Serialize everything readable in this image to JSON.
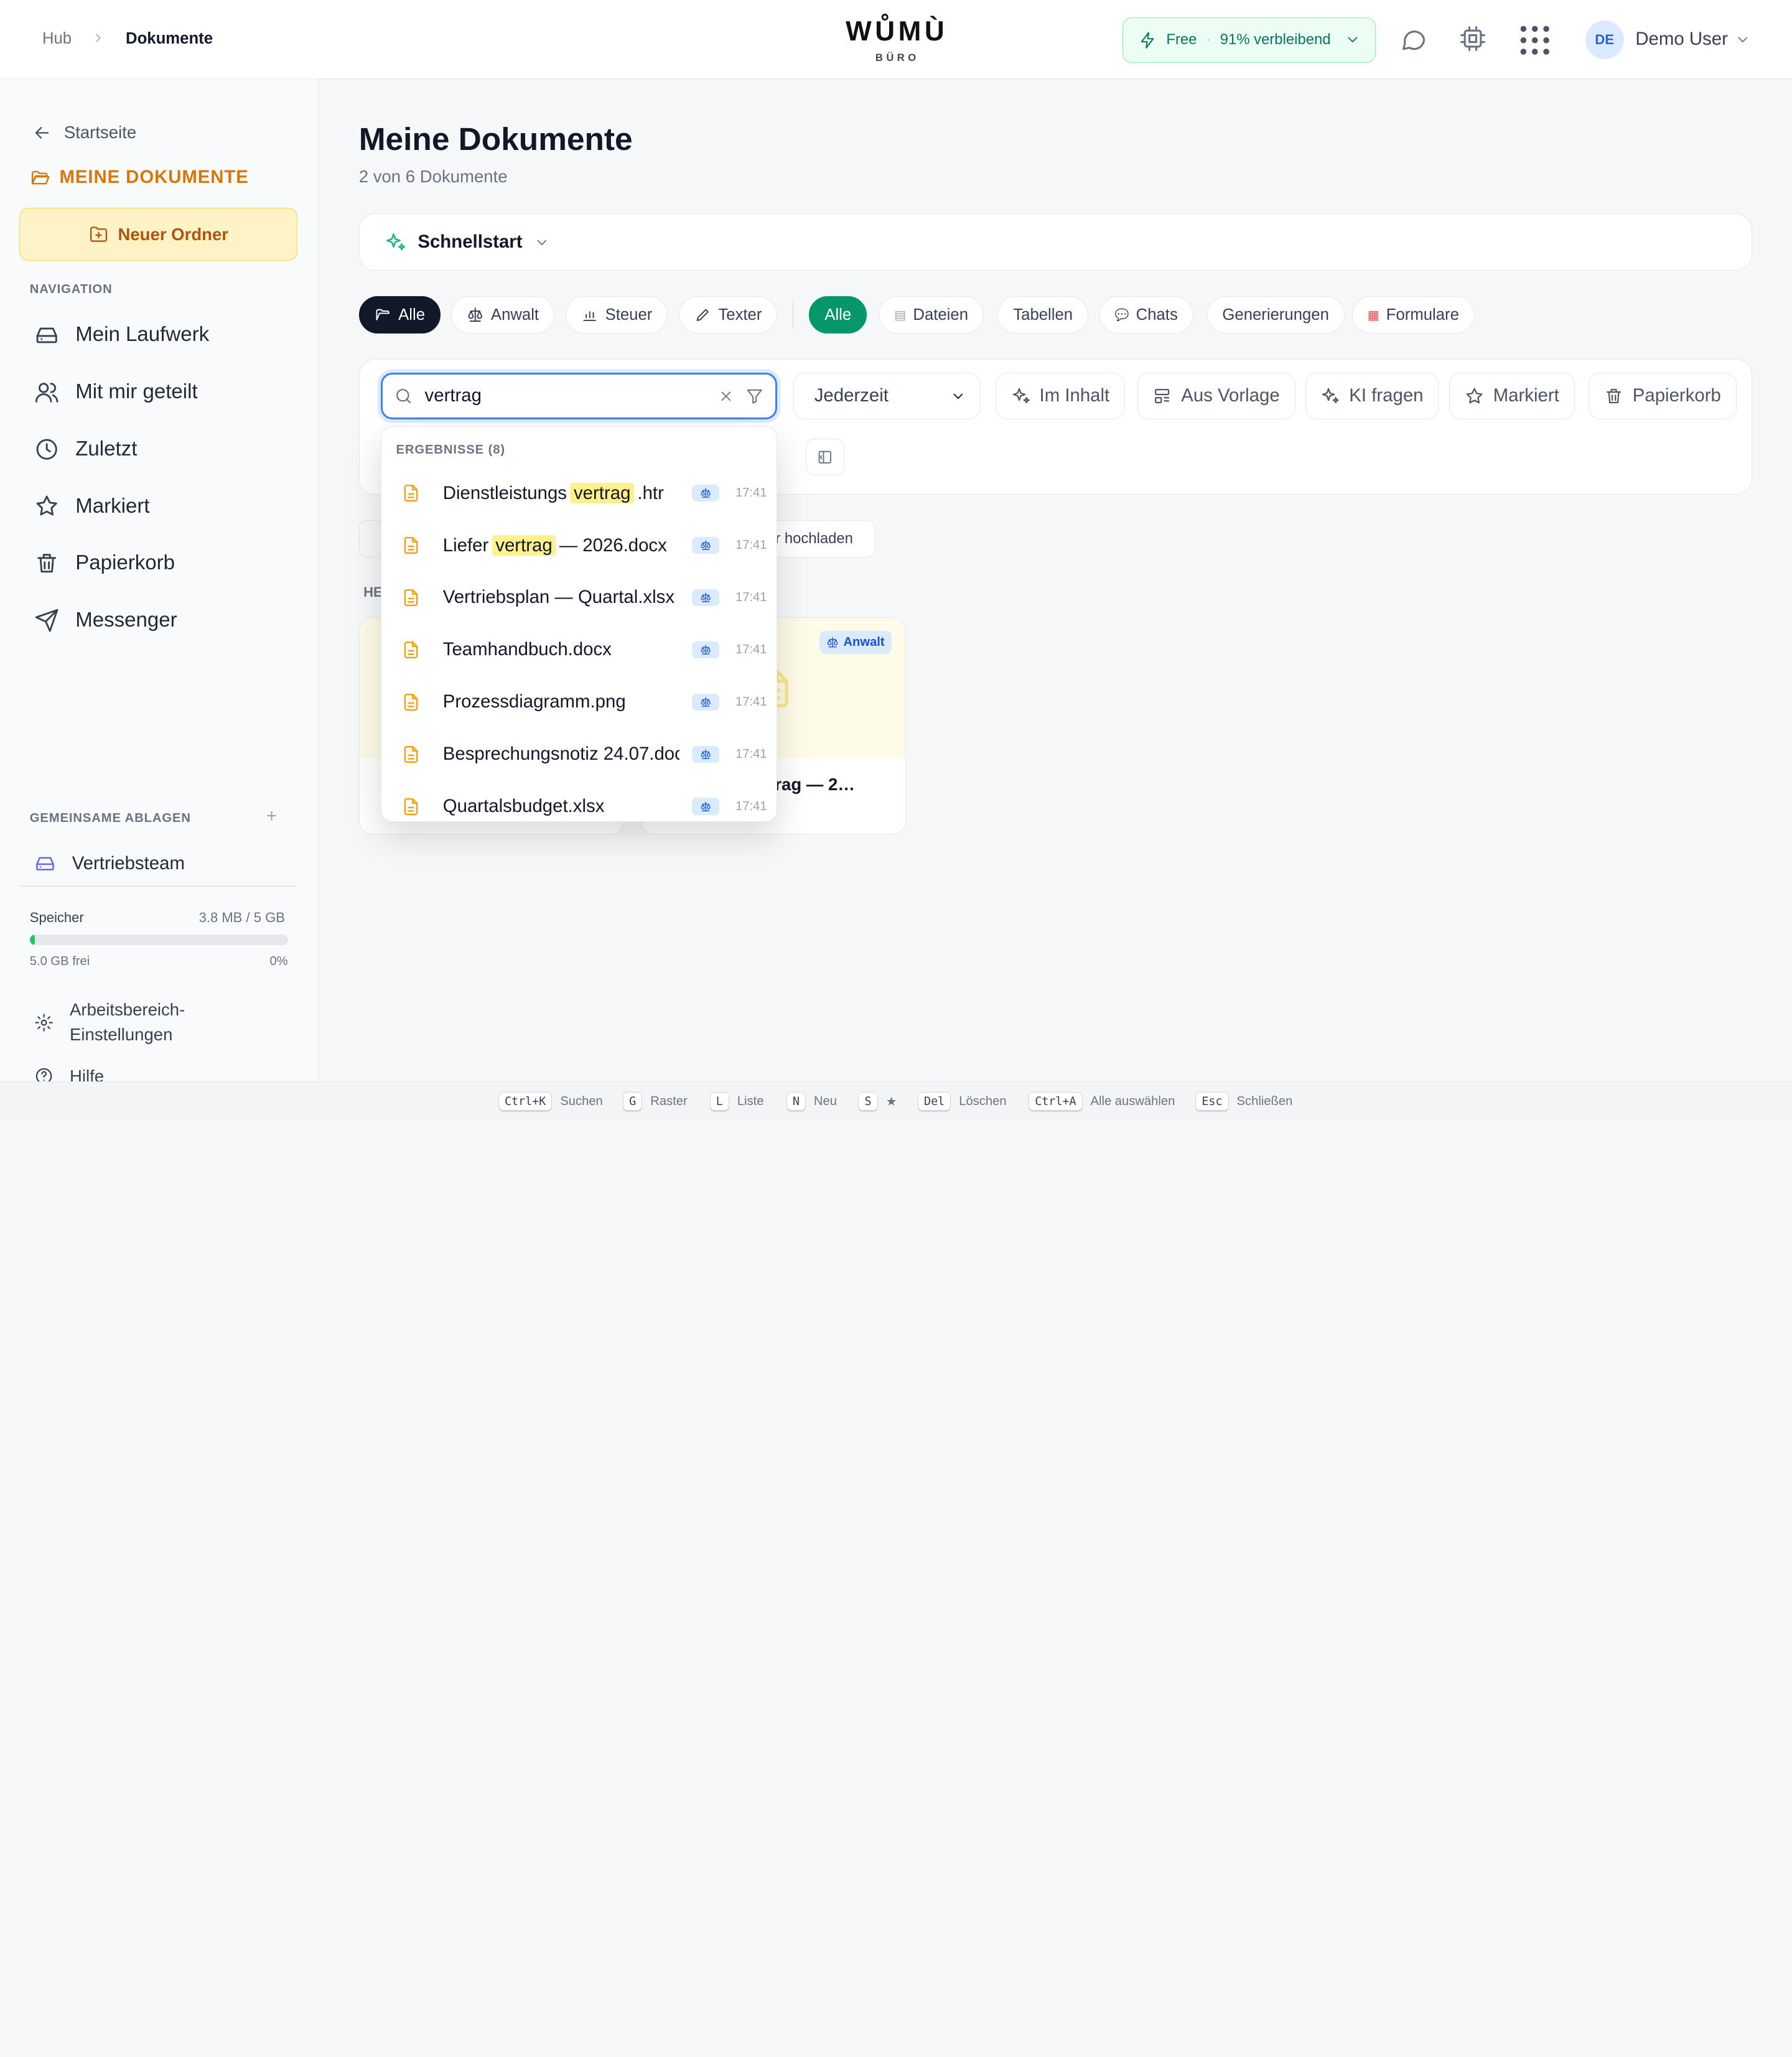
{
  "header": {
    "breadcrumb": [
      "Hub",
      "Dokumente"
    ],
    "logo": "WŮMÙ",
    "logo_sub": "BÜRO",
    "plan_name": "Free",
    "plan_sep": "·",
    "plan_remaining": "91% verbleibend",
    "user_initials": "DE",
    "user_name": "Demo User"
  },
  "sidebar": {
    "back_label": "Startseite",
    "section_title": "MEINE DOKUMENTE",
    "new_folder": "Neuer Ordner",
    "nav_label": "NAVIGATION",
    "nav_items": [
      {
        "label": "Mein Laufwerk",
        "icon": "drive-icon"
      },
      {
        "label": "Mit mir geteilt",
        "icon": "users-icon"
      },
      {
        "label": "Zuletzt",
        "icon": "clock-icon"
      },
      {
        "label": "Markiert",
        "icon": "star-icon"
      },
      {
        "label": "Papierkorb",
        "icon": "trash-icon"
      },
      {
        "label": "Messenger",
        "icon": "send-icon"
      }
    ],
    "shared_label": "GEMEINSAME ABLAGEN",
    "shared_add": "+",
    "shared_items": [
      "Vertriebsteam"
    ],
    "storage_label": "Speicher",
    "storage_used": "3.8 MB / 5 GB",
    "storage_percent": 0.01,
    "storage_free": "5.0 GB frei",
    "storage_pct_text": "0%",
    "settings_line1": "Arbeitsbereich-",
    "settings_line2": "Einstellungen",
    "help": "Hilfe"
  },
  "main": {
    "title": "Meine Dokumente",
    "subtitle": "2 von 6 Dokumente",
    "quickstart": "Schnellstart",
    "category_chips": [
      "Alle",
      "Anwalt",
      "Steuer",
      "Texter"
    ],
    "type_chips": [
      "Alle",
      "Dateien",
      "Tabellen",
      "Chats",
      "Generierungen",
      "Formulare"
    ],
    "search_value": "vertrag",
    "time_filter": "Jederzeit",
    "filter_buttons": [
      "Im Inhalt",
      "Aus Vorlage",
      "KI fragen",
      "Markiert",
      "Papierkorb"
    ],
    "upload_partial": "r hochladen",
    "section_partial": "HE",
    "card_badge": "Anwalt",
    "card_name_partial": "rag — 2…"
  },
  "dropdown": {
    "label": "ERGEBNISSE (8)",
    "results": [
      {
        "pre": "Dienstleistungs",
        "hl": "vertrag",
        "post": ".htr",
        "time": "17:41"
      },
      {
        "pre": "Liefer",
        "hl": "vertrag",
        "post": "— 2026.docx",
        "time": "17:41"
      },
      {
        "pre": "Vertriebsplan — Quartal.xlsx",
        "hl": "",
        "post": "",
        "time": "17:41"
      },
      {
        "pre": "Teamhandbuch.docx",
        "hl": "",
        "post": "",
        "time": "17:41"
      },
      {
        "pre": "Prozessdiagramm.png",
        "hl": "",
        "post": "",
        "time": "17:41"
      },
      {
        "pre": "Besprechungsnotiz 24.07.doc",
        "hl": "",
        "post": "",
        "time": "17:41"
      },
      {
        "pre": "Quartalsbudget.xlsx",
        "hl": "",
        "post": "",
        "time": "17:41"
      }
    ]
  },
  "footer": {
    "shortcuts": [
      {
        "key": "Ctrl+K",
        "label": "Suchen"
      },
      {
        "key": "G",
        "label": "Raster"
      },
      {
        "key": "L",
        "label": "Liste"
      },
      {
        "key": "N",
        "label": "Neu"
      },
      {
        "key": "S",
        "label": "★"
      },
      {
        "key": "Del",
        "label": "Löschen"
      },
      {
        "key": "Ctrl+A",
        "label": "Alle auswählen"
      },
      {
        "key": "Esc",
        "label": "Schließen"
      }
    ]
  },
  "colors": {
    "accent": "#059669",
    "brand": "#d97706",
    "search_focus": "#3b82f6"
  }
}
